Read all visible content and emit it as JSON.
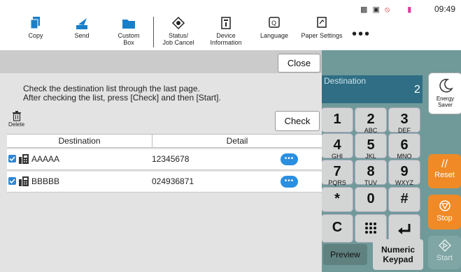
{
  "status_bar": {
    "clock": "09:49"
  },
  "toolbar": {
    "items": [
      {
        "label": "Copy",
        "icon": "copy-icon"
      },
      {
        "label": "Send",
        "icon": "send-icon"
      },
      {
        "label": "Custom Box",
        "icon": "folder-icon"
      },
      {
        "label": "Status/\nJob Cancel",
        "icon": "status-icon"
      },
      {
        "label": "Device\nInformation",
        "icon": "device-info-icon"
      },
      {
        "label": "Language",
        "icon": "language-icon"
      },
      {
        "label": "Paper Settings",
        "icon": "paper-settings-icon"
      }
    ],
    "more_label": "•••"
  },
  "background": {
    "destination_title": "Destination",
    "destination_count": "2",
    "keys": [
      {
        "big": "1",
        "small": ""
      },
      {
        "big": "2",
        "small": "ABC"
      },
      {
        "big": "3",
        "small": "DEF"
      },
      {
        "big": "4",
        "small": "GHI"
      },
      {
        "big": "5",
        "small": "JKL"
      },
      {
        "big": "6",
        "small": "MNO"
      },
      {
        "big": "7",
        "small": "PQRS"
      },
      {
        "big": "8",
        "small": "TUV"
      },
      {
        "big": "9",
        "small": "WXYZ"
      },
      {
        "big": "*",
        "small": ""
      },
      {
        "big": "0",
        "small": ""
      },
      {
        "big": "#",
        "small": ""
      }
    ],
    "clear_key": "C",
    "preview_label": "Preview",
    "numeric_keypad_label": "Numeric Keypad",
    "energy_saver_label": "Energy Saver",
    "reset_label": "Reset",
    "stop_label": "Stop",
    "start_label": "Start",
    "colors": {
      "reset": "#f08a26",
      "stop": "#f08a26",
      "start": "#7fa6a5"
    }
  },
  "dialog": {
    "close_label": "Close",
    "message_line1": "Check the destination list through the last page.",
    "message_line2": "After checking the list, press [Check] and then [Start].",
    "delete_label": "Delete",
    "check_label": "Check",
    "columns": [
      "Destination",
      "Detail"
    ],
    "rows": [
      {
        "name": "AAAAA",
        "detail": "12345678"
      },
      {
        "name": "BBBBB",
        "detail": "024936871"
      }
    ]
  }
}
